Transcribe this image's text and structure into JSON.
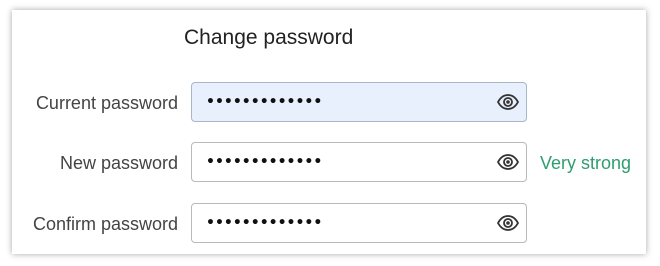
{
  "form": {
    "title": "Change password",
    "fields": [
      {
        "label": "Current password",
        "value": "•••••••••••••"
      },
      {
        "label": "New password",
        "value": "•••••••••••••"
      },
      {
        "label": "Confirm password",
        "value": "•••••••••••••"
      }
    ],
    "strength": {
      "label": "Very strong",
      "color": "#2e9e6e"
    },
    "icons": {
      "toggle_visibility": "eye-icon"
    }
  }
}
